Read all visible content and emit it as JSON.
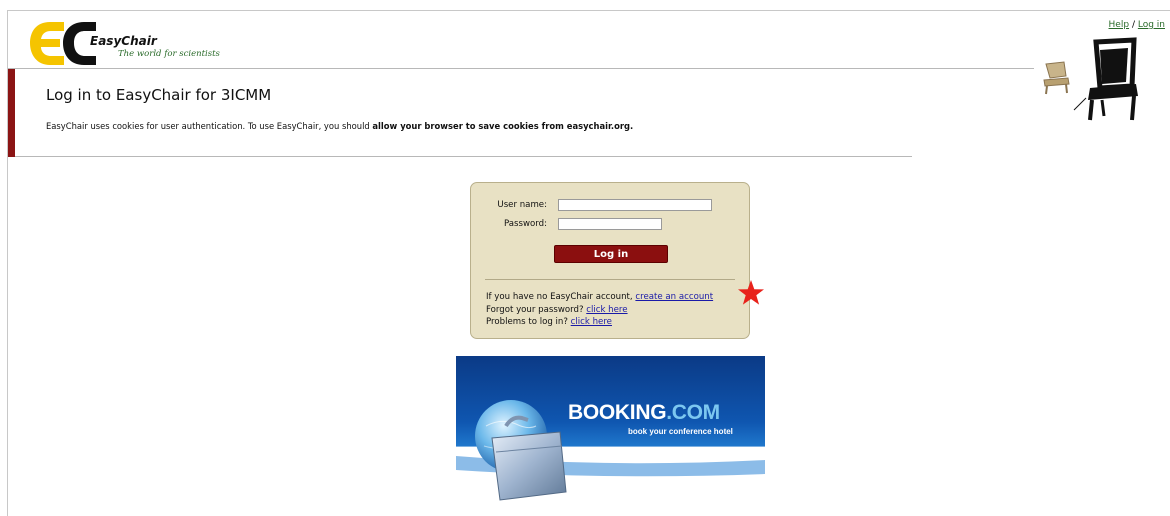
{
  "header": {
    "logo_name": "EasyChair",
    "logo_tagline": "The world for scientists",
    "help_link": "Help",
    "separator": "/",
    "login_link": "Log in"
  },
  "page": {
    "title": "Log in to EasyChair for 3ICMM",
    "cookie_text_1": "EasyChair uses cookies for user authentication. To use EasyChair, you should ",
    "cookie_text_bold": "allow your browser to save cookies from easychair.org."
  },
  "login_form": {
    "username_label": "User name:",
    "username_value": "",
    "password_label": "Password:",
    "password_value": "",
    "login_button": "Log in",
    "no_account_text": "If you have no EasyChair account, ",
    "create_account_link": "create an account",
    "forgot_text": "Forgot your password? ",
    "forgot_link": "click here",
    "problems_text": "Problems to log in? ",
    "problems_link": "click here"
  },
  "ad": {
    "brand_main": "BOOKING",
    "brand_dot_com": ".COM",
    "tagline": "book your conference hotel"
  },
  "colors": {
    "accent_red": "#8b1414",
    "login_box_bg": "#e8e1c4",
    "link_blue": "#1a1aa8",
    "header_link_green": "#2a6b2a",
    "ad_blue": "#0a3f8c"
  },
  "icons": {
    "logo": "easychair-logo-icon",
    "chair": "chair-illustration-icon",
    "star": "star-marker-icon",
    "globe": "globe-icon",
    "suitcase": "suitcase-icon"
  }
}
